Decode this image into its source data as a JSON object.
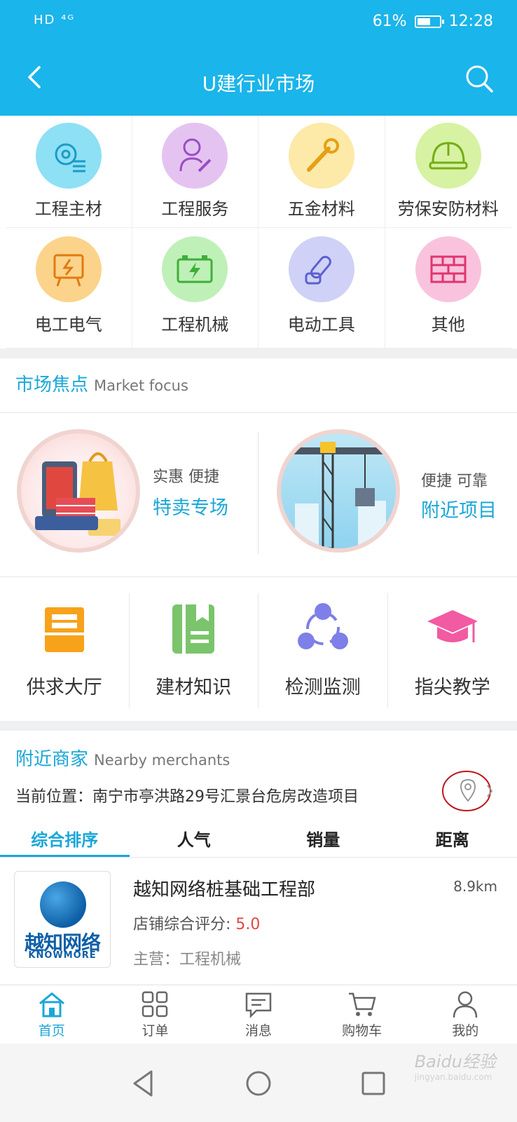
{
  "status_bar": {
    "left_icons": "HD ⁴ᴳ",
    "battery": "61%",
    "time": "12:28",
    "battery_level": 0.61
  },
  "header": {
    "title": "U建行业市场"
  },
  "categories": [
    {
      "label": "工程主材",
      "icon": "gear-list-icon",
      "color": "#8ee0f5"
    },
    {
      "label": "工程服务",
      "icon": "worker-wrench-icon",
      "color": "#e4c3f1"
    },
    {
      "label": "五金材料",
      "icon": "wrench-icon",
      "color": "#fde9a8"
    },
    {
      "label": "劳保安防材料",
      "icon": "helmet-icon",
      "color": "#d7f2a3"
    },
    {
      "label": "电工电气",
      "icon": "electric-panel-icon",
      "color": "#fcd38b"
    },
    {
      "label": "工程机械",
      "icon": "battery-icon",
      "color": "#bff0b8"
    },
    {
      "label": "电动工具",
      "icon": "chainsaw-icon",
      "color": "#cfd2f6"
    },
    {
      "label": "其他",
      "icon": "bricks-icon",
      "color": "#f9c3dd"
    }
  ],
  "market_focus": {
    "title": "市场焦点",
    "title_en": "Market focus",
    "cards": [
      {
        "sub": "实惠  便捷",
        "main": "特卖专场",
        "image": "shopping-illustration"
      },
      {
        "sub": "便捷  可靠",
        "main": "附近项目",
        "image": "crane-illustration"
      }
    ]
  },
  "services": [
    {
      "label": "供求大厅",
      "icon": "hall-icon",
      "color": "#f7a21b"
    },
    {
      "label": "建材知识",
      "icon": "book-icon",
      "color": "#7ac46b"
    },
    {
      "label": "检测监测",
      "icon": "network-icon",
      "color": "#7e7fe8"
    },
    {
      "label": "指尖教学",
      "icon": "graduation-cap-icon",
      "color": "#f25aa2"
    }
  ],
  "nearby": {
    "title": "附近商家",
    "title_en": "Nearby merchants",
    "location": "当前位置：南宁市亭洪路29号汇景台危房改造项目"
  },
  "sort_tabs": [
    "综合排序",
    "人气",
    "销量",
    "距离"
  ],
  "merchant": {
    "logo_cn": "越知网络",
    "logo_en": "KNOWMORE",
    "name": "越知网络桩基础工程部",
    "distance": "8.9km",
    "rating_label": "店铺综合评分: ",
    "rating": "5.0",
    "main_business": "主营：工程机械"
  },
  "bottom_nav": [
    {
      "label": "首页",
      "icon": "home-icon"
    },
    {
      "label": "订单",
      "icon": "grid-icon"
    },
    {
      "label": "消息",
      "icon": "message-icon"
    },
    {
      "label": "购物车",
      "icon": "cart-icon"
    },
    {
      "label": "我的",
      "icon": "person-icon"
    }
  ],
  "watermark": {
    "text": "Baidu经验",
    "sub": "jingyan.baidu.com"
  },
  "colors": {
    "primary": "#1ab5ea",
    "accent_text": "#1ba7d8",
    "rating": "#e0483f"
  }
}
